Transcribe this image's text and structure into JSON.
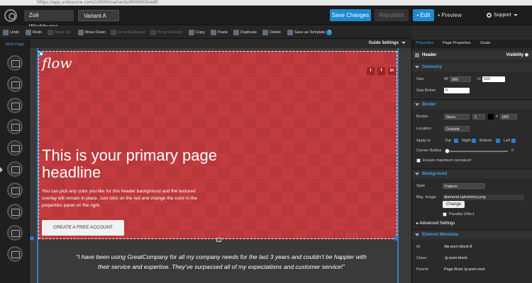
{
  "browser": {
    "url": "https://app.unbounce.com/1/0000/variants/0000000/edit"
  },
  "topbar": {
    "user": "Zoë Washburne",
    "variant": "Variant A",
    "save": "Save Changes",
    "republish": "Republish",
    "edit": "Edit",
    "preview": "Preview",
    "support": "Support"
  },
  "toolbar": {
    "undo": "Undo",
    "redo": "Redo",
    "move_up": "Move Up",
    "move_down": "Move Down",
    "send_backward": "Send Backward",
    "bring_forward": "Bring Forward",
    "copy": "Copy",
    "paste": "Paste",
    "duplicate": "Duplicate",
    "delete": "Delete",
    "save_template": "Save as Template",
    "help": "?"
  },
  "left": {
    "title": "Main Page"
  },
  "canvas": {
    "guide_settings": "Guide Settings",
    "brand": "flow",
    "social": [
      "t",
      "f",
      "in"
    ],
    "headline": "This is your primary page headline",
    "body": "You can pick any color you like for this header background and the textured overlay will remain in place. Just click on the red and change the color in the properties panel on the right.",
    "cta": "CREATE A FREE ACCOUNT",
    "testimonial": "“I have been using GreatCompany for all my company needs for the last 3 years and couldn’t be happier with their service and expertise. They’ve surpassed all of my expectations and customer service!”"
  },
  "panel": {
    "tabs": [
      "Properties",
      "Page Properties",
      "Goals"
    ],
    "header": "Header",
    "visibility": "Visibility",
    "geometry": "Geometry",
    "size": "Size",
    "w_label": "W:",
    "w": "980",
    "h_label": "H:",
    "h": "515",
    "gap_below": "Gap Below",
    "gap": "0",
    "border": "Border",
    "border_label": "Border",
    "border_style": "None",
    "border_width": "1",
    "border_hash": "#",
    "border_color": "000",
    "location": "Location",
    "location_value": "Outside",
    "apply_to": "Apply to",
    "top": "Top",
    "right": "Right",
    "bottom": "Bottom",
    "left": "Left",
    "corner_radius": "Corner Radius",
    "corner_value": "0",
    "ensure": "Ensure maximum curvature!",
    "background": "Background",
    "style": "Style",
    "style_value": "Pattern",
    "bkg_image": "Bkg. Image",
    "bkg_value": "diamond-upholstery.png",
    "change": "Change",
    "parallax": "Parallax Effect",
    "advanced": "Advanced Settings",
    "metadata": "Element Metadata",
    "id_label": "Id:",
    "id_value": "#lp-pom-block-8",
    "class_label": "Class:",
    "class_value": ".lp-pom-block",
    "parent_label": "Parent:",
    "parent_value": "Page Root: lp-pom-root"
  },
  "colors": {
    "accent": "#1e8bd0",
    "hero": "#c23b3e"
  }
}
